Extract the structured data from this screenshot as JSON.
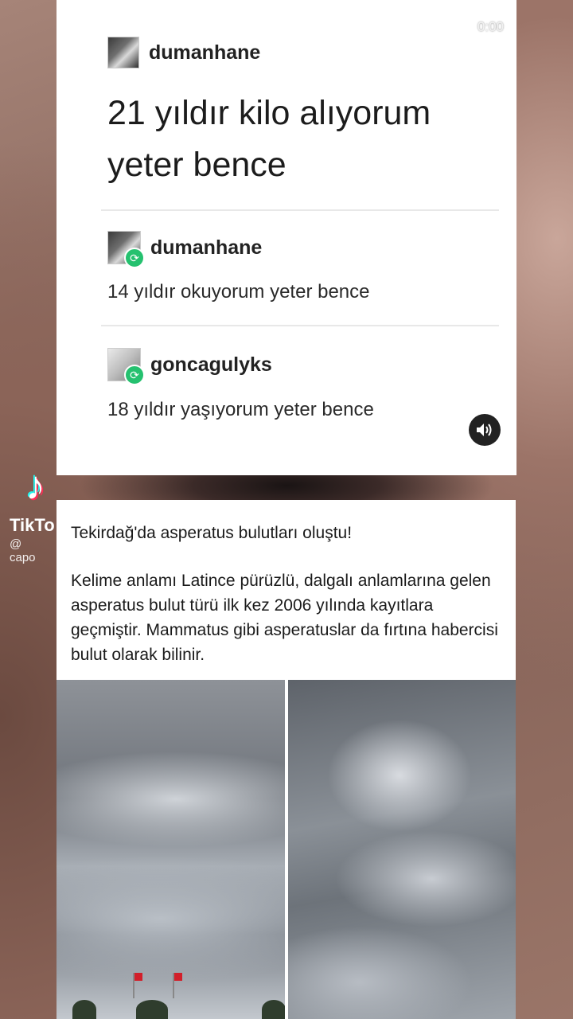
{
  "video": {
    "timestamp": "0:00"
  },
  "top_post": {
    "original": {
      "username": "dumanhane",
      "text_line1": "21 yıldır kilo alıyorum",
      "text_line2": "yeter bence"
    },
    "replies": [
      {
        "username": "dumanhane",
        "text": "14 yıldır okuyorum yeter bence"
      },
      {
        "username": "goncagulyks",
        "text": "18 yıldır yaşıyorum yeter bence"
      }
    ]
  },
  "watermark": {
    "brand": "TikTo",
    "handle": "@ capo"
  },
  "bottom_post": {
    "headline": "Tekirdağ'da asperatus bulutları oluştu!",
    "body": "Kelime anlamı Latince pürüzlü, dalgalı anlamlarına gelen asperatus bulut türü ilk kez 2006 yılında kayıtlara geçmiştir. Mammatus gibi asperatuslar da fırtına habercisi bulut olarak bilinir."
  },
  "icons": {
    "sound": "speaker-icon",
    "reblog": "reblog-icon",
    "tiktok": "tiktok-logo-icon"
  },
  "colors": {
    "reblog_green": "#25c16f",
    "flag_red": "#d21f2a"
  }
}
